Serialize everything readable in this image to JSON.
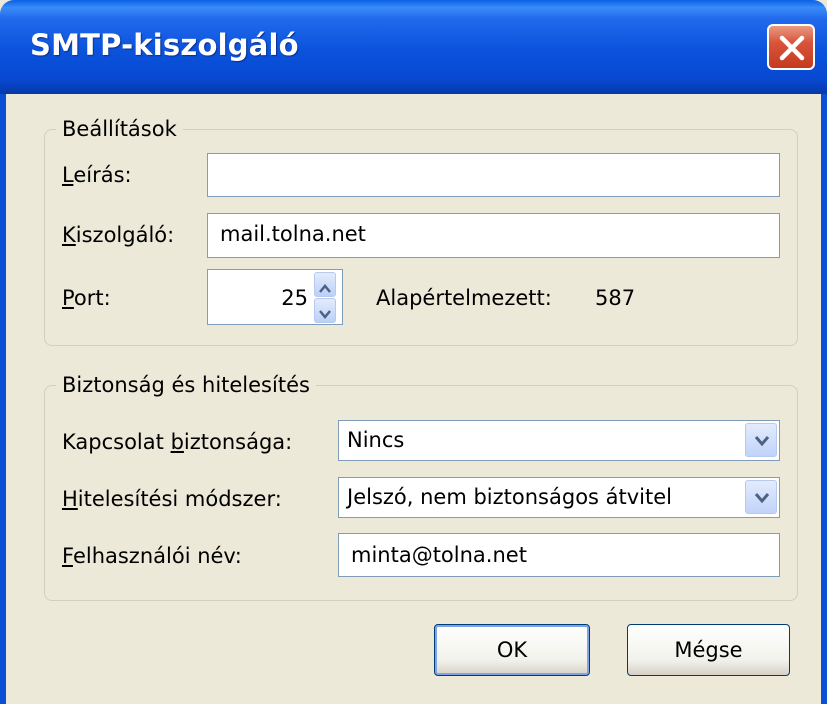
{
  "window": {
    "title": "SMTP-kiszolgáló",
    "close_icon": "close-icon"
  },
  "settings": {
    "legend": "Beállítások",
    "description": {
      "label_accel": "L",
      "label_rest": "eírás:",
      "value": ""
    },
    "server": {
      "label_accel": "K",
      "label_rest": "iszolgáló:",
      "value": "mail.tolna.net"
    },
    "port": {
      "label_accel": "P",
      "label_rest": "ort:",
      "value": "25",
      "default_label": "Alapértelmezett:",
      "default_value": "587"
    }
  },
  "security": {
    "legend": "Biztonság és hitelesítés",
    "connection": {
      "label_pre": "Kapcsolat ",
      "label_accel": "b",
      "label_post": "iztonsága:",
      "value": "Nincs"
    },
    "auth": {
      "label_accel": "H",
      "label_rest": "itelesítési módszer:",
      "value": "Jelszó, nem biztonságos átvitel"
    },
    "username": {
      "label_accel": "F",
      "label_rest": "elhasználói név:",
      "value": "minta@tolna.net"
    }
  },
  "buttons": {
    "ok": "OK",
    "cancel": "Mégse"
  },
  "colors": {
    "title_bar": "#0a52dc",
    "dialog_bg": "#ece9d8",
    "close_button": "#d8543a",
    "field_border": "#7f9db9"
  }
}
